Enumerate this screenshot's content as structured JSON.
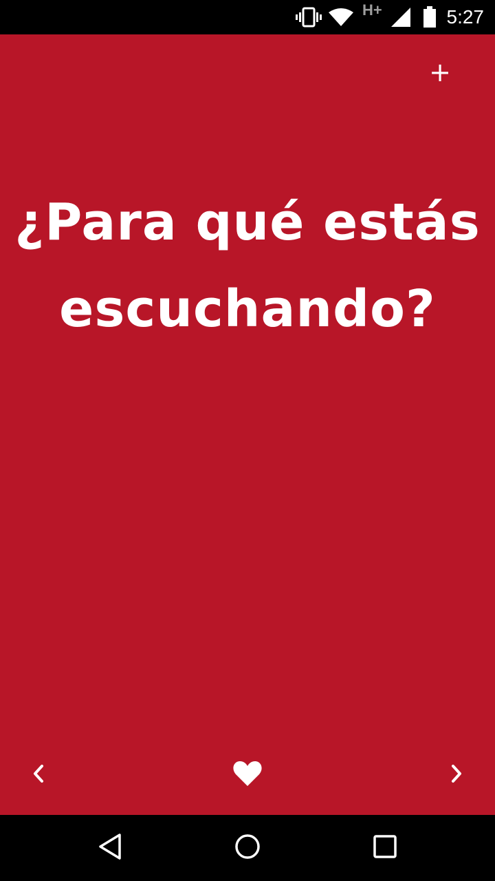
{
  "status_bar": {
    "time": "5:27",
    "network_label": "H+",
    "icons": [
      "vibrate-icon",
      "wifi-icon",
      "signal-icon",
      "battery-icon"
    ]
  },
  "toolbar": {
    "add_label": "+"
  },
  "card": {
    "question": "¿Para qué estás escuchando?",
    "background_color": "#b81628",
    "text_color": "#ffffff"
  },
  "card_nav": {
    "icons": [
      "chevron-left-icon",
      "heart-icon",
      "chevron-right-icon"
    ]
  },
  "system_nav": {
    "icons": [
      "back-icon",
      "home-icon",
      "recents-icon"
    ]
  }
}
